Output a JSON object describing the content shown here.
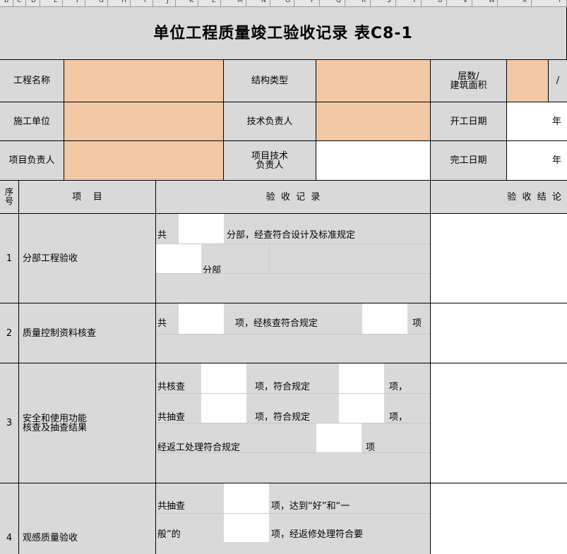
{
  "column_headers": [
    "B",
    "C",
    "D",
    "E",
    "F",
    "G",
    "H",
    "I",
    "J",
    "K",
    "L",
    "M",
    "N",
    "O",
    "P",
    "Q",
    "R",
    "S",
    "T",
    "U",
    "V",
    "W",
    "X",
    "Y"
  ],
  "title": "单位工程质量竣工验收记录  表C8-1",
  "info": {
    "project_name_label": "工程名称",
    "structure_type_label": "结构类型",
    "floors_area_label": "层数/\n建筑面积",
    "floors_area_value": "/",
    "construction_unit_label": "施工单位",
    "tech_lead_label": "技术负责人",
    "start_date_label": "开工日期",
    "start_date_value": "年",
    "project_manager_label": "项目负责人",
    "project_tech_lead_label": "项目技术\n负责人",
    "finish_date_label": "完工日期",
    "finish_date_value": "年"
  },
  "table_header": {
    "seq": "序\n号",
    "item": "项    目",
    "record": "验  收  记  录",
    "conclusion": "验  收  结  论"
  },
  "rows": [
    {
      "seq": "1",
      "item": "分部工程验收",
      "record": {
        "line1_prefix": "共",
        "line1_suffix": "分部，经查符合设计及标准规定",
        "line2_suffix": "分部"
      }
    },
    {
      "seq": "2",
      "item": "质量控制资料核查",
      "record": {
        "prefix": "共",
        "middle": "项，经核查符合规定",
        "suffix": "项"
      }
    },
    {
      "seq": "3",
      "item": "安全和使用功能\n核查及抽查结果",
      "record": {
        "line1_prefix": "共核查",
        "line1_middle": "项，符合规定",
        "line1_suffix": "项，",
        "line2_prefix": "共抽查",
        "line2_middle": "项，符合规定",
        "line2_suffix": "项，",
        "line3_prefix": "经返工处理符合规定",
        "line3_suffix": "项"
      }
    },
    {
      "seq": "4",
      "item": "观感质量验收",
      "record": {
        "line1_prefix": "共抽查",
        "line1_suffix": "项，达到“好”和“一",
        "line2_prefix": "般”的",
        "line2_suffix": "项，经返修处理符合要"
      }
    }
  ],
  "colors": {
    "header_gray": "#d9d9d9",
    "input_orange": "#f2c9a4",
    "grid": "#000000"
  }
}
